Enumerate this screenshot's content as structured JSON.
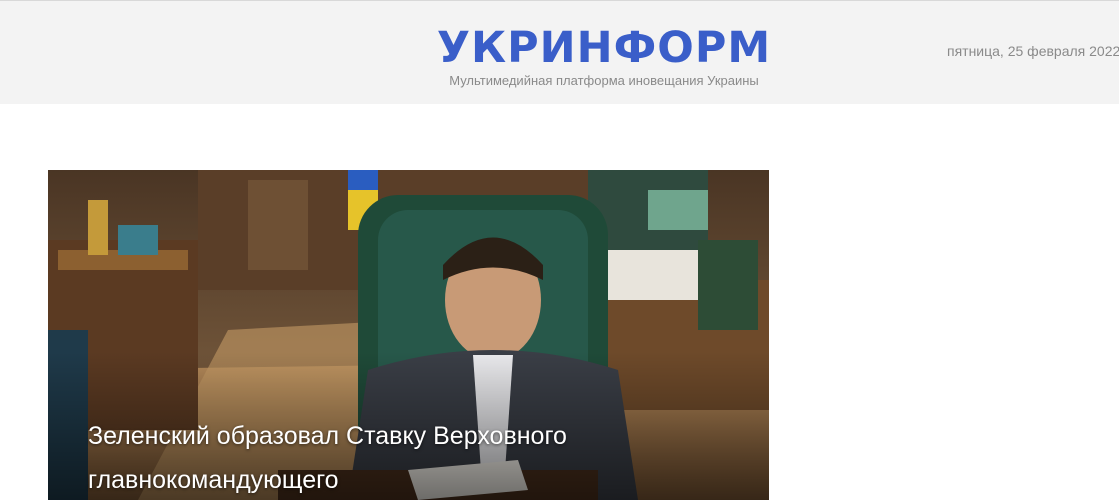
{
  "header": {
    "logo_text": "УКРИНФОРМ",
    "tagline": "Мультимедийная платформа иновещания Украины",
    "date": "пятница, 25 февраля 2022,"
  },
  "featured": {
    "headline": "Зеленский образовал Ставку Верховного главнокомандующего",
    "image_alt": "photo-of-man-reading-documents-at-desk"
  },
  "colors": {
    "brand": "#3a5ec9",
    "header_bg": "#f3f3f3",
    "muted_text": "#8a8a8a"
  }
}
